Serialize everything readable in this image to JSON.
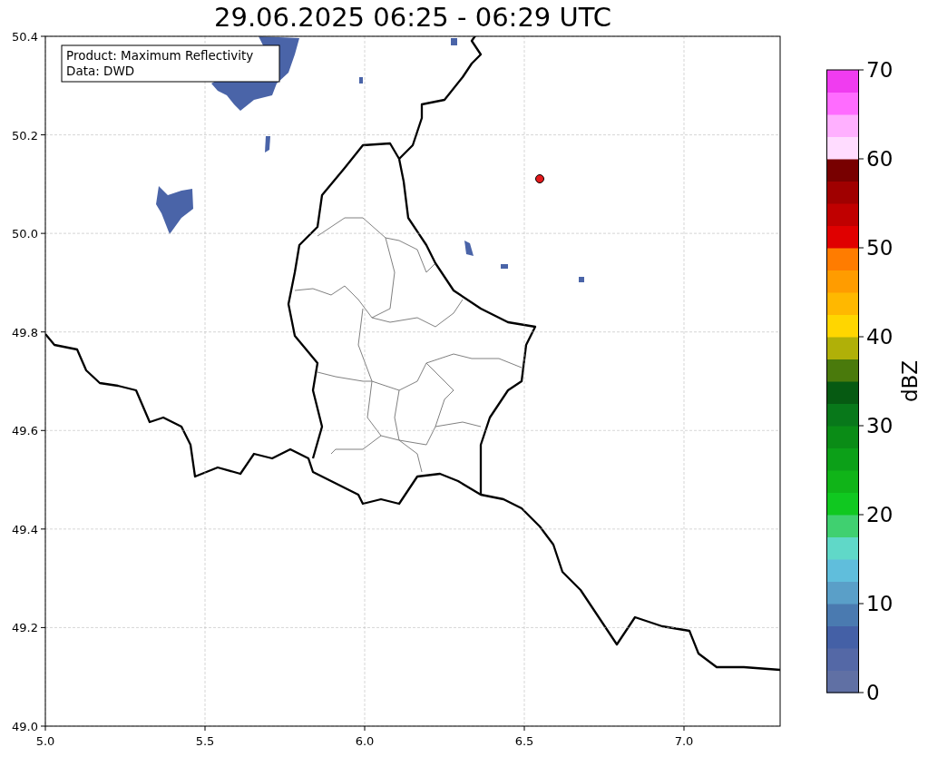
{
  "title": "29.06.2025 06:25 - 06:29 UTC",
  "legend": {
    "lines": [
      "Product: Maximum Reflectivity",
      "Data: DWD"
    ]
  },
  "x_axis": {
    "ticks": [
      "5.0",
      "5.5",
      "6.0",
      "6.5",
      "7.0"
    ]
  },
  "y_axis": {
    "ticks": [
      "50.4",
      "50.2",
      "50.0",
      "49.8",
      "49.6",
      "49.4",
      "49.2",
      "49.0"
    ]
  },
  "colorbar": {
    "label": "dBZ",
    "ticks": [
      "70",
      "60",
      "50",
      "40",
      "30",
      "20",
      "10",
      "0"
    ],
    "segments": [
      {
        "color": "#6070a4"
      },
      {
        "color": "#5468a6"
      },
      {
        "color": "#4460a6"
      },
      {
        "color": "#4a7ab0"
      },
      {
        "color": "#5a9fc8"
      },
      {
        "color": "#60bedc"
      },
      {
        "color": "#60d8c8"
      },
      {
        "color": "#40d070"
      },
      {
        "color": "#10c820"
      },
      {
        "color": "#10b418"
      },
      {
        "color": "#0ca018"
      },
      {
        "color": "#0a8c16"
      },
      {
        "color": "#08781a"
      },
      {
        "color": "#065a12"
      },
      {
        "color": "#4a7a0c"
      },
      {
        "color": "#b0b008"
      },
      {
        "color": "#ffd600"
      },
      {
        "color": "#ffb800"
      },
      {
        "color": "#ff9c00"
      },
      {
        "color": "#ff7c00"
      },
      {
        "color": "#e00000"
      },
      {
        "color": "#c00000"
      },
      {
        "color": "#a00000"
      },
      {
        "color": "#780000"
      },
      {
        "color": "#ffdcff"
      },
      {
        "color": "#ffb0ff"
      },
      {
        "color": "#ff6cff"
      },
      {
        "color": "#f03cf0"
      }
    ]
  }
}
